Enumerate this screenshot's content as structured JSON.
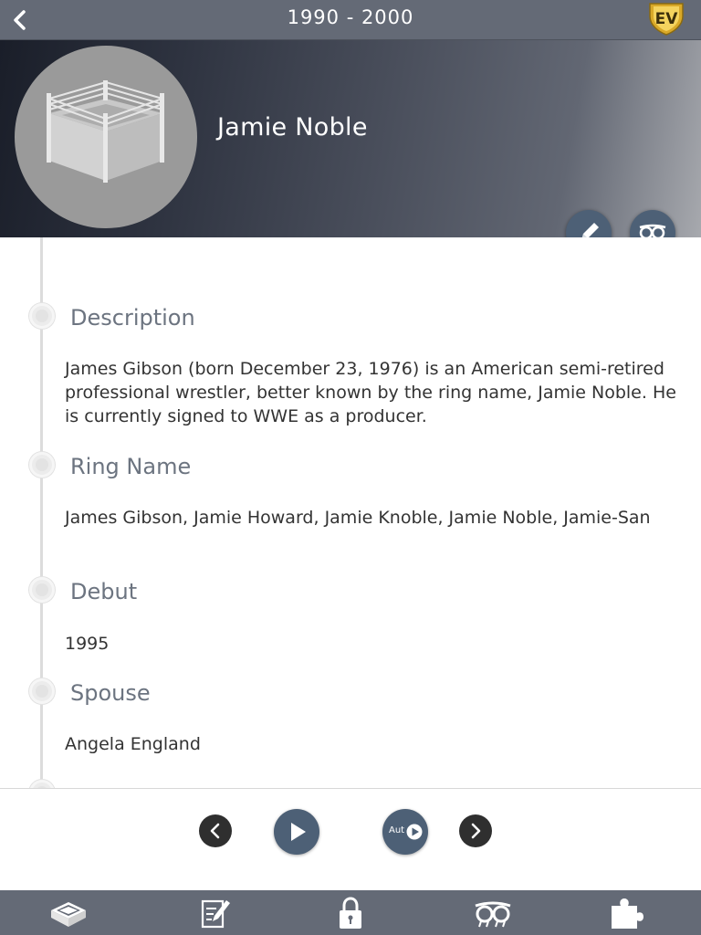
{
  "nav": {
    "title": "1990 - 2000",
    "back_icon": "chevron-left-icon",
    "logo_text": "EV"
  },
  "profile": {
    "name": "Jamie Noble",
    "avatar_icon": "wrestling-ring-icon",
    "actions": [
      {
        "icon": "pencil-icon",
        "action": "edit"
      },
      {
        "icon": "follow-icon",
        "action": "follow"
      }
    ]
  },
  "sections": [
    {
      "title": "Description",
      "text": "James Gibson (born December 23, 1976) is an American semi-retired professional wrestler, better known by the ring name, Jamie Noble. He is currently signed to WWE as a producer."
    },
    {
      "title": "Ring Name",
      "text": "James Gibson, Jamie Howard, Jamie Knoble, Jamie Noble, Jamie-San"
    },
    {
      "title": "Debut",
      "text": "1995"
    },
    {
      "title": "Spouse",
      "text": "Angela England"
    }
  ],
  "controls": {
    "auto_label": "Aut",
    "icons": [
      "chevron-left-icon",
      "play-icon",
      "autoplay-icon",
      "chevron-right-icon"
    ]
  },
  "tabbar": {
    "icons": [
      "ring-icon",
      "notes-icon",
      "lock-icon",
      "glasses-icon",
      "puzzle-icon"
    ]
  },
  "colors": {
    "nav_bg": "#646a76",
    "accent": "#4d6076",
    "section_title": "#6c7480"
  }
}
